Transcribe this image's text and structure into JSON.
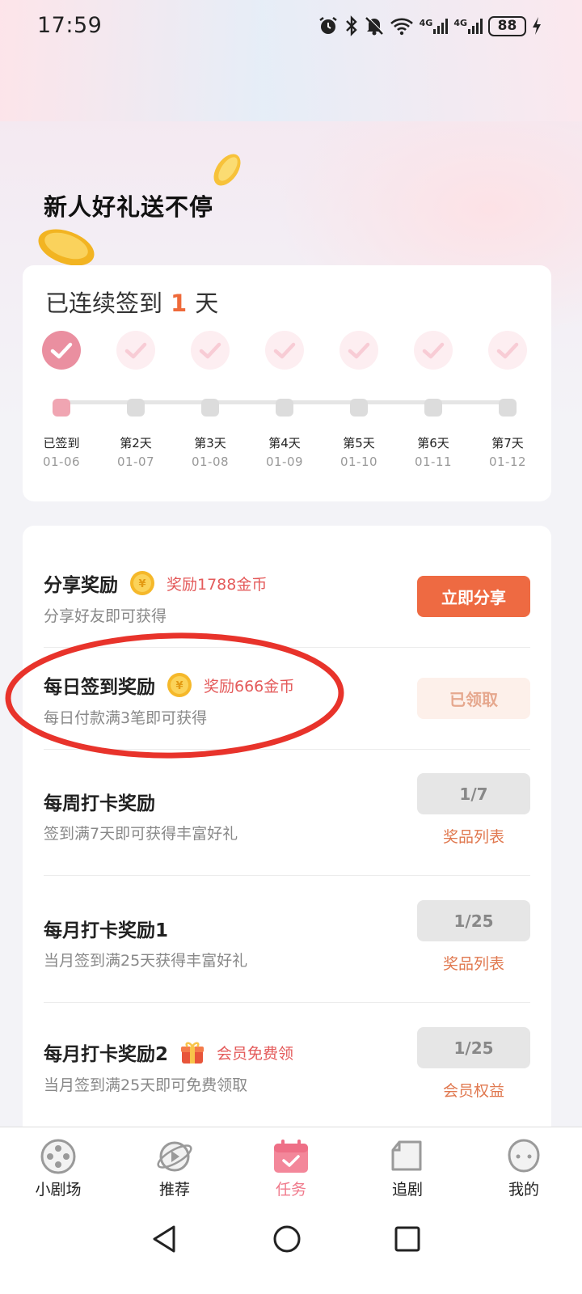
{
  "status_bar": {
    "time": "17:59",
    "network_1": "4G",
    "network_2": "4G",
    "battery": "88"
  },
  "hero": {
    "title": "新人好礼送不停"
  },
  "signin": {
    "title_prefix": "已连续签到",
    "streak_days": "1",
    "title_suffix": "天",
    "days": [
      {
        "label": "已签到",
        "date": "01-06",
        "signed": true
      },
      {
        "label": "第2天",
        "date": "01-07",
        "signed": false
      },
      {
        "label": "第3天",
        "date": "01-08",
        "signed": false
      },
      {
        "label": "第4天",
        "date": "01-09",
        "signed": false
      },
      {
        "label": "第5天",
        "date": "01-10",
        "signed": false
      },
      {
        "label": "第6天",
        "date": "01-11",
        "signed": false
      },
      {
        "label": "第7天",
        "date": "01-12",
        "signed": false
      }
    ]
  },
  "tasks": [
    {
      "title": "分享奖励",
      "icon": "coin-icon",
      "reward": "奖励1788金币",
      "desc": "分享好友即可获得",
      "button": "立即分享"
    },
    {
      "title": "每日签到奖励",
      "icon": "coin-icon",
      "reward": "奖励666金币",
      "desc": "每日付款满3笔即可获得",
      "button": "已领取"
    },
    {
      "title": "每周打卡奖励",
      "desc": "签到满7天即可获得丰富好礼",
      "progress": "1/7",
      "link": "奖品列表"
    },
    {
      "title": "每月打卡奖励1",
      "desc": "当月签到满25天获得丰富好礼",
      "progress": "1/25",
      "link": "奖品列表"
    },
    {
      "title": "每月打卡奖励2",
      "icon": "gift-icon",
      "reward": "会员免费领",
      "desc": "当月签到满25天即可免费领取",
      "progress": "1/25",
      "link": "会员权益"
    }
  ],
  "bottom_nav": [
    {
      "label": "小剧场",
      "icon": "film-reel-icon",
      "active": false
    },
    {
      "label": "推荐",
      "icon": "planet-play-icon",
      "active": false
    },
    {
      "label": "任务",
      "icon": "calendar-check-icon",
      "active": true
    },
    {
      "label": "追剧",
      "icon": "folder-icon",
      "active": false
    },
    {
      "label": "我的",
      "icon": "smiley-face-icon",
      "active": false
    }
  ],
  "colors": {
    "accent_orange": "#ee6a42",
    "reward_red": "#e45b5b",
    "active_pink": "#f07a8c",
    "annotation_red": "#e8332b"
  }
}
